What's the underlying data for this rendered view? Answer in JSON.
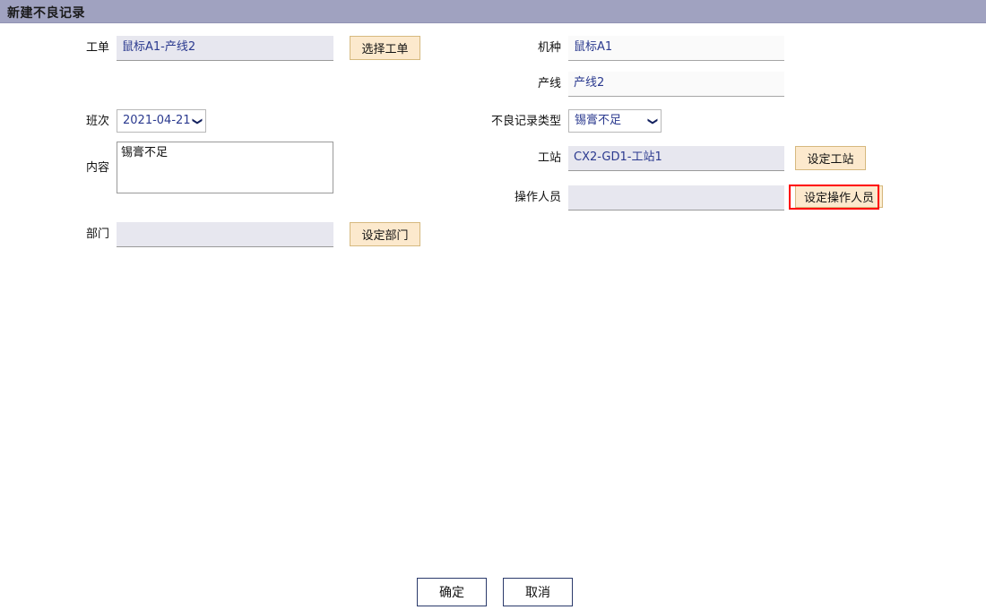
{
  "window": {
    "title": "新建不良记录"
  },
  "form": {
    "left": {
      "work_order": {
        "label": "工单",
        "value": "鼠标A1-产线2",
        "button": "选择工单"
      },
      "shift": {
        "label": "班次",
        "value": "2021-04-21畺",
        "chevron": "❯"
      },
      "content": {
        "label": "内容",
        "value": "锡膏不足",
        "placeholder": ""
      },
      "department": {
        "label": "部门",
        "value": "",
        "button": "设定部门"
      }
    },
    "right": {
      "model": {
        "label": "机种",
        "value": "鼠标A1"
      },
      "line": {
        "label": "产线",
        "value": "产线2"
      },
      "defect_type": {
        "label": "不良记录类型",
        "value": "锡膏不足",
        "chevron": "❯"
      },
      "station": {
        "label": "工站",
        "value": "CX2-GD1-工站1",
        "button": "设定工站"
      },
      "operator": {
        "label": "操作人员",
        "value": "",
        "button": "设定操作人员"
      }
    }
  },
  "footer": {
    "confirm": "确定",
    "cancel": "取消"
  },
  "colors": {
    "titlebar": "#a0a2c0",
    "field_fill": "#e7e7ef",
    "field_fill_light": "#fafafa",
    "value_text": "#2b3a8f",
    "button_fill": "#fce9cd",
    "button_border": "#d6b97f",
    "highlight": "#ff0000",
    "footer_button_border": "#2b3a6b"
  }
}
